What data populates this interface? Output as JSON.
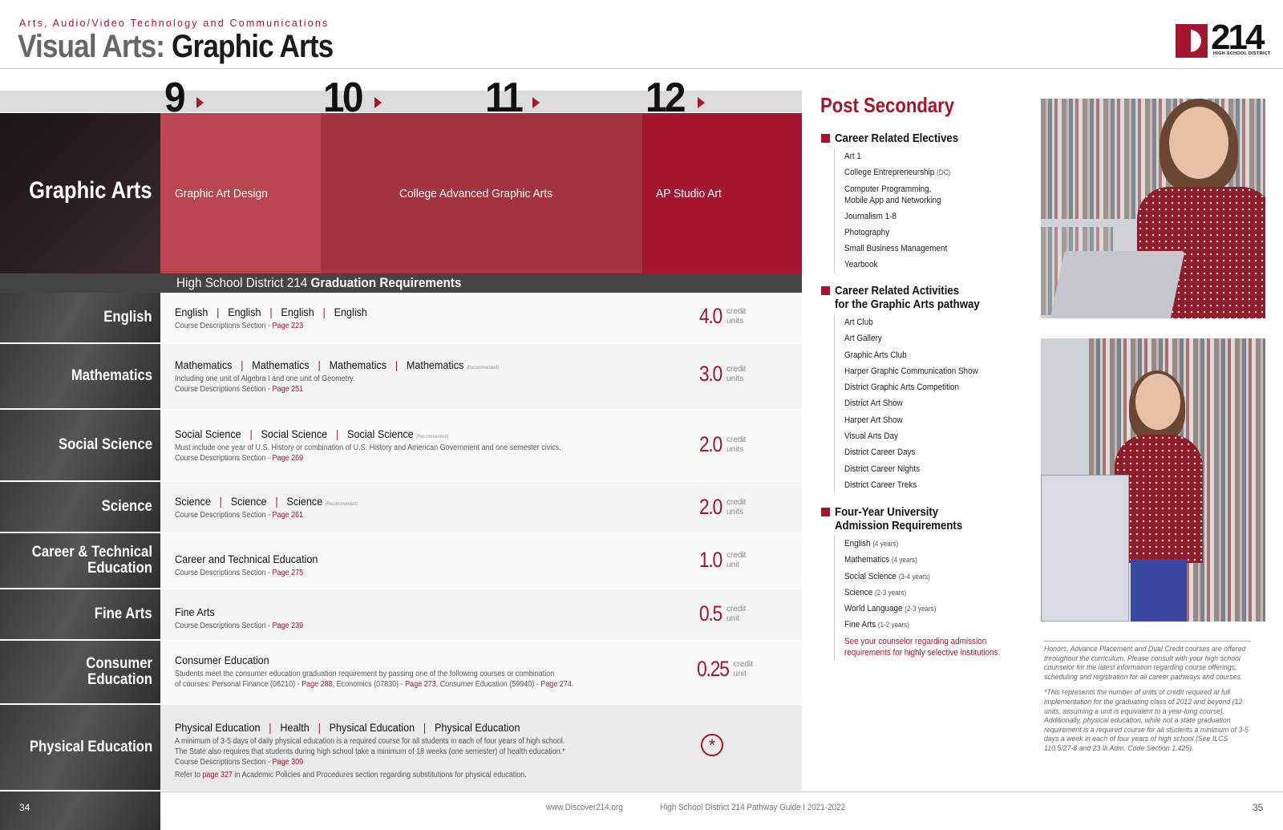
{
  "header": {
    "subtitle": "Arts, Audio/Video Technology and Communications",
    "title_part1": "Visual Arts:",
    "title_part2": " Graphic Arts",
    "logo_number": "214",
    "logo_text": "HIGH SCHOOL DISTRICT"
  },
  "grades": [
    "9",
    "10",
    "11",
    "12"
  ],
  "pathway": {
    "name": "Graphic Arts",
    "courses": [
      "Graphic Art Design",
      "College Advanced Graphic Arts",
      "AP Studio Art"
    ]
  },
  "grad_requirements": {
    "prefix": "High School District 214 ",
    "bold": "Graduation Requirements"
  },
  "requirements": [
    {
      "label": "English",
      "courses": [
        "English",
        "English",
        "English",
        "English"
      ],
      "recommended": "",
      "lines": [],
      "section_prefix": "Course Descriptions Section - ",
      "page": "Page 223",
      "credit": "4.0",
      "unit": "credit units"
    },
    {
      "label": "Mathematics",
      "courses": [
        "Mathematics",
        "Mathematics",
        "Mathematics",
        "Mathematics"
      ],
      "recommended": "(Recommended)",
      "lines": [
        "Including one unit of Algebra I and one unit of Geometry."
      ],
      "section_prefix": "Course Descriptions Section - ",
      "page": "Page 251",
      "credit": "3.0",
      "unit": "credit units"
    },
    {
      "label": "Social Science",
      "courses": [
        "Social Science",
        "Social Science",
        "Social Science"
      ],
      "recommended": "(Recommended)",
      "lines": [
        "Must include one year of U.S. History or combination of U.S. History and American Government and one semester civics."
      ],
      "section_prefix": "Course Descriptions Section - ",
      "page": "Page 269",
      "credit": "2.0",
      "unit": "credit units"
    },
    {
      "label": "Science",
      "courses": [
        "Science",
        "Science",
        "Science"
      ],
      "recommended": "(Recommended)",
      "lines": [],
      "section_prefix": "Course Descriptions Section - ",
      "page": "Page 261",
      "credit": "2.0",
      "unit": "credit units"
    },
    {
      "label": "Career & Technical Education",
      "courses": [
        "Career and Technical Education"
      ],
      "recommended": "",
      "lines": [],
      "section_prefix": "Course Descriptions Section - ",
      "page": "Page 275",
      "credit": "1.0",
      "unit": "credit unit"
    },
    {
      "label": "Fine Arts",
      "courses": [
        "Fine Arts"
      ],
      "recommended": "",
      "lines": [],
      "section_prefix": "Course Descriptions Section - ",
      "page": "Page 239",
      "credit": "0.5",
      "unit": "credit unit"
    },
    {
      "label": "Consumer Education",
      "courses": [
        "Consumer Education"
      ],
      "recommended": "",
      "lines": [
        "Students meet the consumer education graduation requirement by passing one of the following courses or combination"
      ],
      "consumer_line": {
        "a": "of courses: Personal Finance (06210) - ",
        "p1": "Page 288",
        "b": ", Economics (07830) - ",
        "p2": "Page 273",
        "c": ", Consumer Education (59940) - ",
        "p3": "Page 274",
        "d": "."
      },
      "section_prefix": "",
      "page": "",
      "credit": "0.25",
      "unit": "credit unit"
    },
    {
      "label": "Physical Education",
      "courses": [
        "Physical Education",
        "Health",
        "Physical Education",
        "Physical Education"
      ],
      "recommended": "",
      "lines": [
        "A minimum of 3-5 days of daily physical education is a required course for all students in each of four years of high school.",
        "The State also requires that students during high school take a minimum of 18 weeks (one semester) of health education.*"
      ],
      "section_prefix": "Course Descriptions Section - ",
      "page": "Page 309",
      "refer": {
        "a": "Refer to ",
        "p": "page 327",
        "b": " in Academic Policies and Procedures section regarding substitutions for physical education."
      },
      "icon": "asterisk-circle-icon"
    }
  ],
  "post_secondary": {
    "title": "Post Secondary",
    "electives_title": "Career Related Electives",
    "electives": [
      {
        "name": "Art 1",
        "sub": ""
      },
      {
        "name": "College Entrepreneurship ",
        "sub": "(DC)"
      },
      {
        "name": "Computer Programming,",
        "name2": "Mobile App and Networking",
        "sub": ""
      },
      {
        "name": "Journalism 1-8",
        "sub": ""
      },
      {
        "name": "Photography",
        "sub": ""
      },
      {
        "name": "Small Business Management",
        "sub": ""
      },
      {
        "name": "Yearbook",
        "sub": ""
      }
    ],
    "activities_title1": "Career Related Activities",
    "activities_title2": "for the Graphic Arts pathway",
    "activities": [
      "Art Club",
      "Art Gallery",
      "Graphic Arts Club",
      "Harper Graphic Communication Show",
      "District Graphic Arts Competition",
      "District Art Show",
      "Harper Art Show",
      "Visual Arts Day",
      "District Career Days",
      "District Career Nights",
      "District Career Treks"
    ],
    "university_title1": "Four-Year University",
    "university_title2": "Admission Requirements",
    "university": [
      {
        "name": "English ",
        "sub": "(4 years)"
      },
      {
        "name": "Mathematics ",
        "sub": "(4 years)"
      },
      {
        "name": "Social Science ",
        "sub": "(3-4 years)"
      },
      {
        "name": "Science ",
        "sub": "(2-3 years)"
      },
      {
        "name": "World Language ",
        "sub": "(2-3 years)"
      },
      {
        "name": "Fine Arts ",
        "sub": "(1-2 years)"
      }
    ],
    "counselor_note1": "See your counselor regarding admission",
    "counselor_note2": "requirements for highly selective institutions."
  },
  "disclaimer": {
    "p1": "Honors, Advance Placement and Dual Credit courses are offered throughout the curriculum. Please consult with your high school counselor for the latest information regarding course offerings, scheduling and registration for all career pathways and courses.",
    "p2": "*This represents the number of units of credit required at full implementation for the graduating class of 2012 and beyond (12 units, assuming a unit is equivalent to a year-long course). Additionally, physical education, while not a state graduation requirement is a required course for all students a minimum of 3-5 days a week in each of four years of high school (See ILCS 110,5/27-6 and 23 Ill.Adm. Code Section 1.425)."
  },
  "footer": {
    "page_left": "34",
    "page_right": "35",
    "site": "www.Discover214.org",
    "guide": "High School District 214 Pathway Guide  I  2021-2022"
  },
  "colors": {
    "accent": "#a3162e",
    "band1": "#b8454f",
    "band2": "#a3333f",
    "band3": "#a3162e"
  }
}
